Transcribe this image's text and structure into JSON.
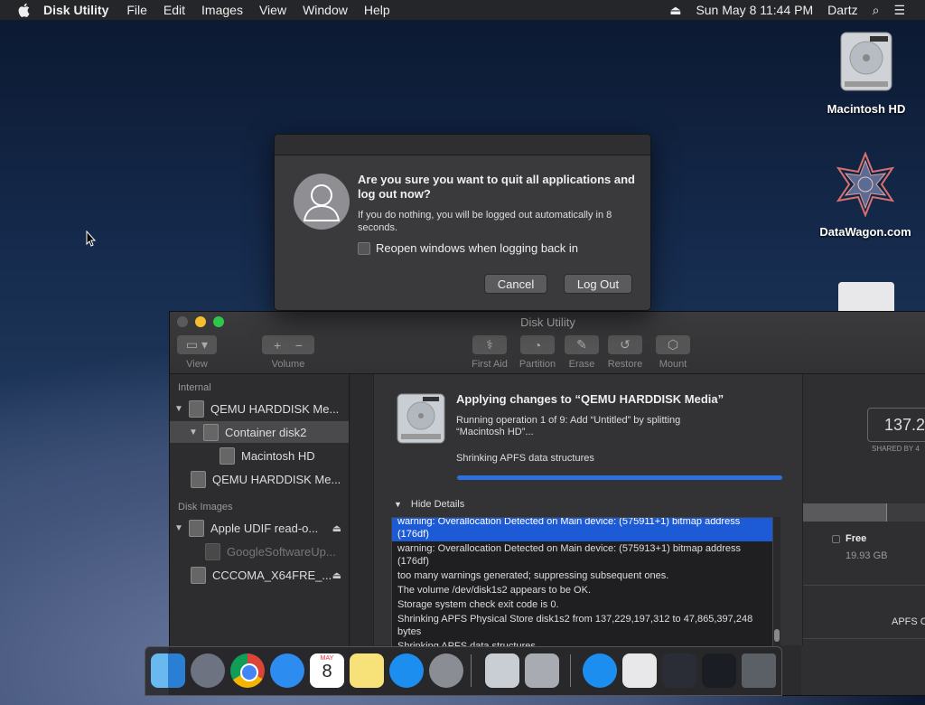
{
  "menubar": {
    "app": "Disk Utility",
    "menus": [
      "File",
      "Edit",
      "Images",
      "View",
      "Window",
      "Help"
    ],
    "datetime": "Sun May 8  11:44 PM",
    "user": "Dartz"
  },
  "desktop": {
    "icons": [
      {
        "label": "Macintosh HD"
      },
      {
        "label": "DataWagon.com"
      }
    ]
  },
  "dialog": {
    "title": "Are you sure you want to quit all applications and log out now?",
    "message": "If you do nothing, you will be logged out automatically in 8 seconds.",
    "checkbox_label": "Reopen windows when logging back in",
    "cancel_label": "Cancel",
    "logout_label": "Log Out"
  },
  "window": {
    "title": "Disk Utility",
    "toolbar": {
      "view_label": "View",
      "volume_label": "Volume",
      "first_aid_label": "First Aid",
      "partition_label": "Partition",
      "erase_label": "Erase",
      "restore_label": "Restore",
      "mount_label": "Mount"
    },
    "sidebar": {
      "internal_header": "Internal",
      "disk_images_header": "Disk Images",
      "items": [
        {
          "label": "QEMU HARDDISK Me..."
        },
        {
          "label": "Container disk2"
        },
        {
          "label": "Macintosh HD"
        },
        {
          "label": "QEMU HARDDISK Me..."
        },
        {
          "label": "Apple UDIF read-o..."
        },
        {
          "label": "GoogleSoftwareUp..."
        },
        {
          "label": "CCCOMA_X64FRE_..."
        }
      ]
    },
    "right_panel": {
      "capacity": "137.23",
      "shared_label": "SHARED BY 4",
      "free_label": "Free",
      "free_size": "19.93 GB",
      "format_label": "APFS C"
    },
    "sheet": {
      "title": "Applying changes to “QEMU HARDDISK Media”",
      "subtitle": "Running operation 1 of 9: Add “Untitled” by splitting “Macintosh HD”...",
      "status": "Shrinking APFS data structures",
      "progress_fraction": 1.0,
      "details_toggle": "Hide Details",
      "log": [
        "warning: Overallocation Detected on Main device: (575911+1) bitmap address (176df)",
        "warning: Overallocation Detected on Main device: (575913+1) bitmap address (176df)",
        "too many warnings generated; suppressing subsequent ones.",
        "The volume /dev/disk1s2 appears to be OK.",
        "Storage system check exit code is 0.",
        "Shrinking APFS Physical Store disk1s2 from 137,229,197,312 to 47,865,397,248 bytes",
        "Shrinking APFS data structures"
      ]
    }
  },
  "dock": {
    "items": [
      "Finder",
      "Launchpad",
      "Chrome",
      "Safari",
      "Calendar",
      "Notes",
      "App Store",
      "System Preferences",
      "Disk Utility",
      "Archive",
      "App Store Downloads",
      "Preview",
      "Terminal",
      "Mission Control",
      "Trash"
    ],
    "calendar_month": "MAY",
    "calendar_day": "8"
  }
}
